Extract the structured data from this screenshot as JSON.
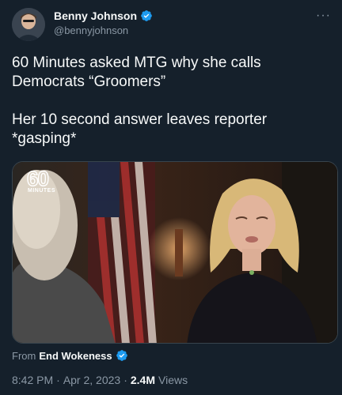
{
  "author": {
    "name": "Benny Johnson",
    "handle": "@bennyjohnson",
    "verified": true
  },
  "more_label": "···",
  "tweet": {
    "paragraphs": [
      "60 Minutes asked MTG why she calls\nDemocrats “Groomers”",
      "Her 10 second answer leaves reporter\n*gasping*"
    ]
  },
  "media": {
    "logo_number": "60",
    "logo_word": "MINUTES"
  },
  "attribution": {
    "prefix": "From",
    "source": "End Wokeness",
    "verified": true
  },
  "meta": {
    "time": "8:42 PM",
    "dot1": "·",
    "date": "Apr 2, 2023",
    "dot2": "·",
    "views_count": "2.4M",
    "views_label": "Views"
  },
  "colors": {
    "background": "#15202b",
    "text_primary": "#f7f9f9",
    "text_secondary": "#8b98a5",
    "verified_blue": "#1d9bf0"
  }
}
